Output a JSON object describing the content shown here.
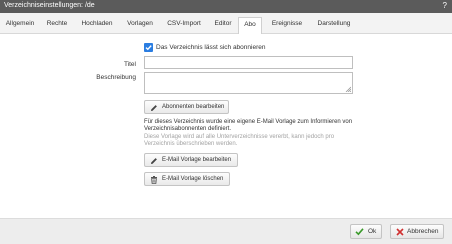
{
  "window": {
    "title": "Verzeichniseinstellungen: /de",
    "help": "?"
  },
  "tabs": [
    {
      "label": "Allgemein"
    },
    {
      "label": "Rechte"
    },
    {
      "label": "Hochladen"
    },
    {
      "label": "Vorlagen"
    },
    {
      "label": "CSV-Import"
    },
    {
      "label": "Editor"
    },
    {
      "label": "Abo",
      "active": true
    },
    {
      "label": "Ereignisse"
    },
    {
      "label": "Darstellung"
    }
  ],
  "form": {
    "subscribe_checkbox": {
      "label": "Das Verzeichnis lässt sich abonnieren",
      "checked": true
    },
    "title_label": "Titel",
    "title_value": "",
    "description_label": "Beschreibung",
    "description_value": ""
  },
  "buttons": {
    "edit_subscribers": "Abonnenten bearbeiten",
    "edit_email_template": "E-Mail Vorlage bearbeiten",
    "delete_email_template": "E-Mail Vorlage löschen"
  },
  "info": {
    "line1": "Für dieses Verzeichnis wurde eine eigene E-Mail Vorlage zum Informieren von Verzeichnisabonnenten definiert.",
    "line2": "Diese Vorlage wird auf alle Unterverzeichnisse vererbt, kann jedoch pro Verzeichnis überschrieben werden."
  },
  "footer": {
    "ok": "Ok",
    "cancel": "Abbrechen"
  },
  "colors": {
    "accent": "#2a7de1",
    "ok_icon": "#3a9a2a",
    "cancel_icon": "#d03030"
  }
}
